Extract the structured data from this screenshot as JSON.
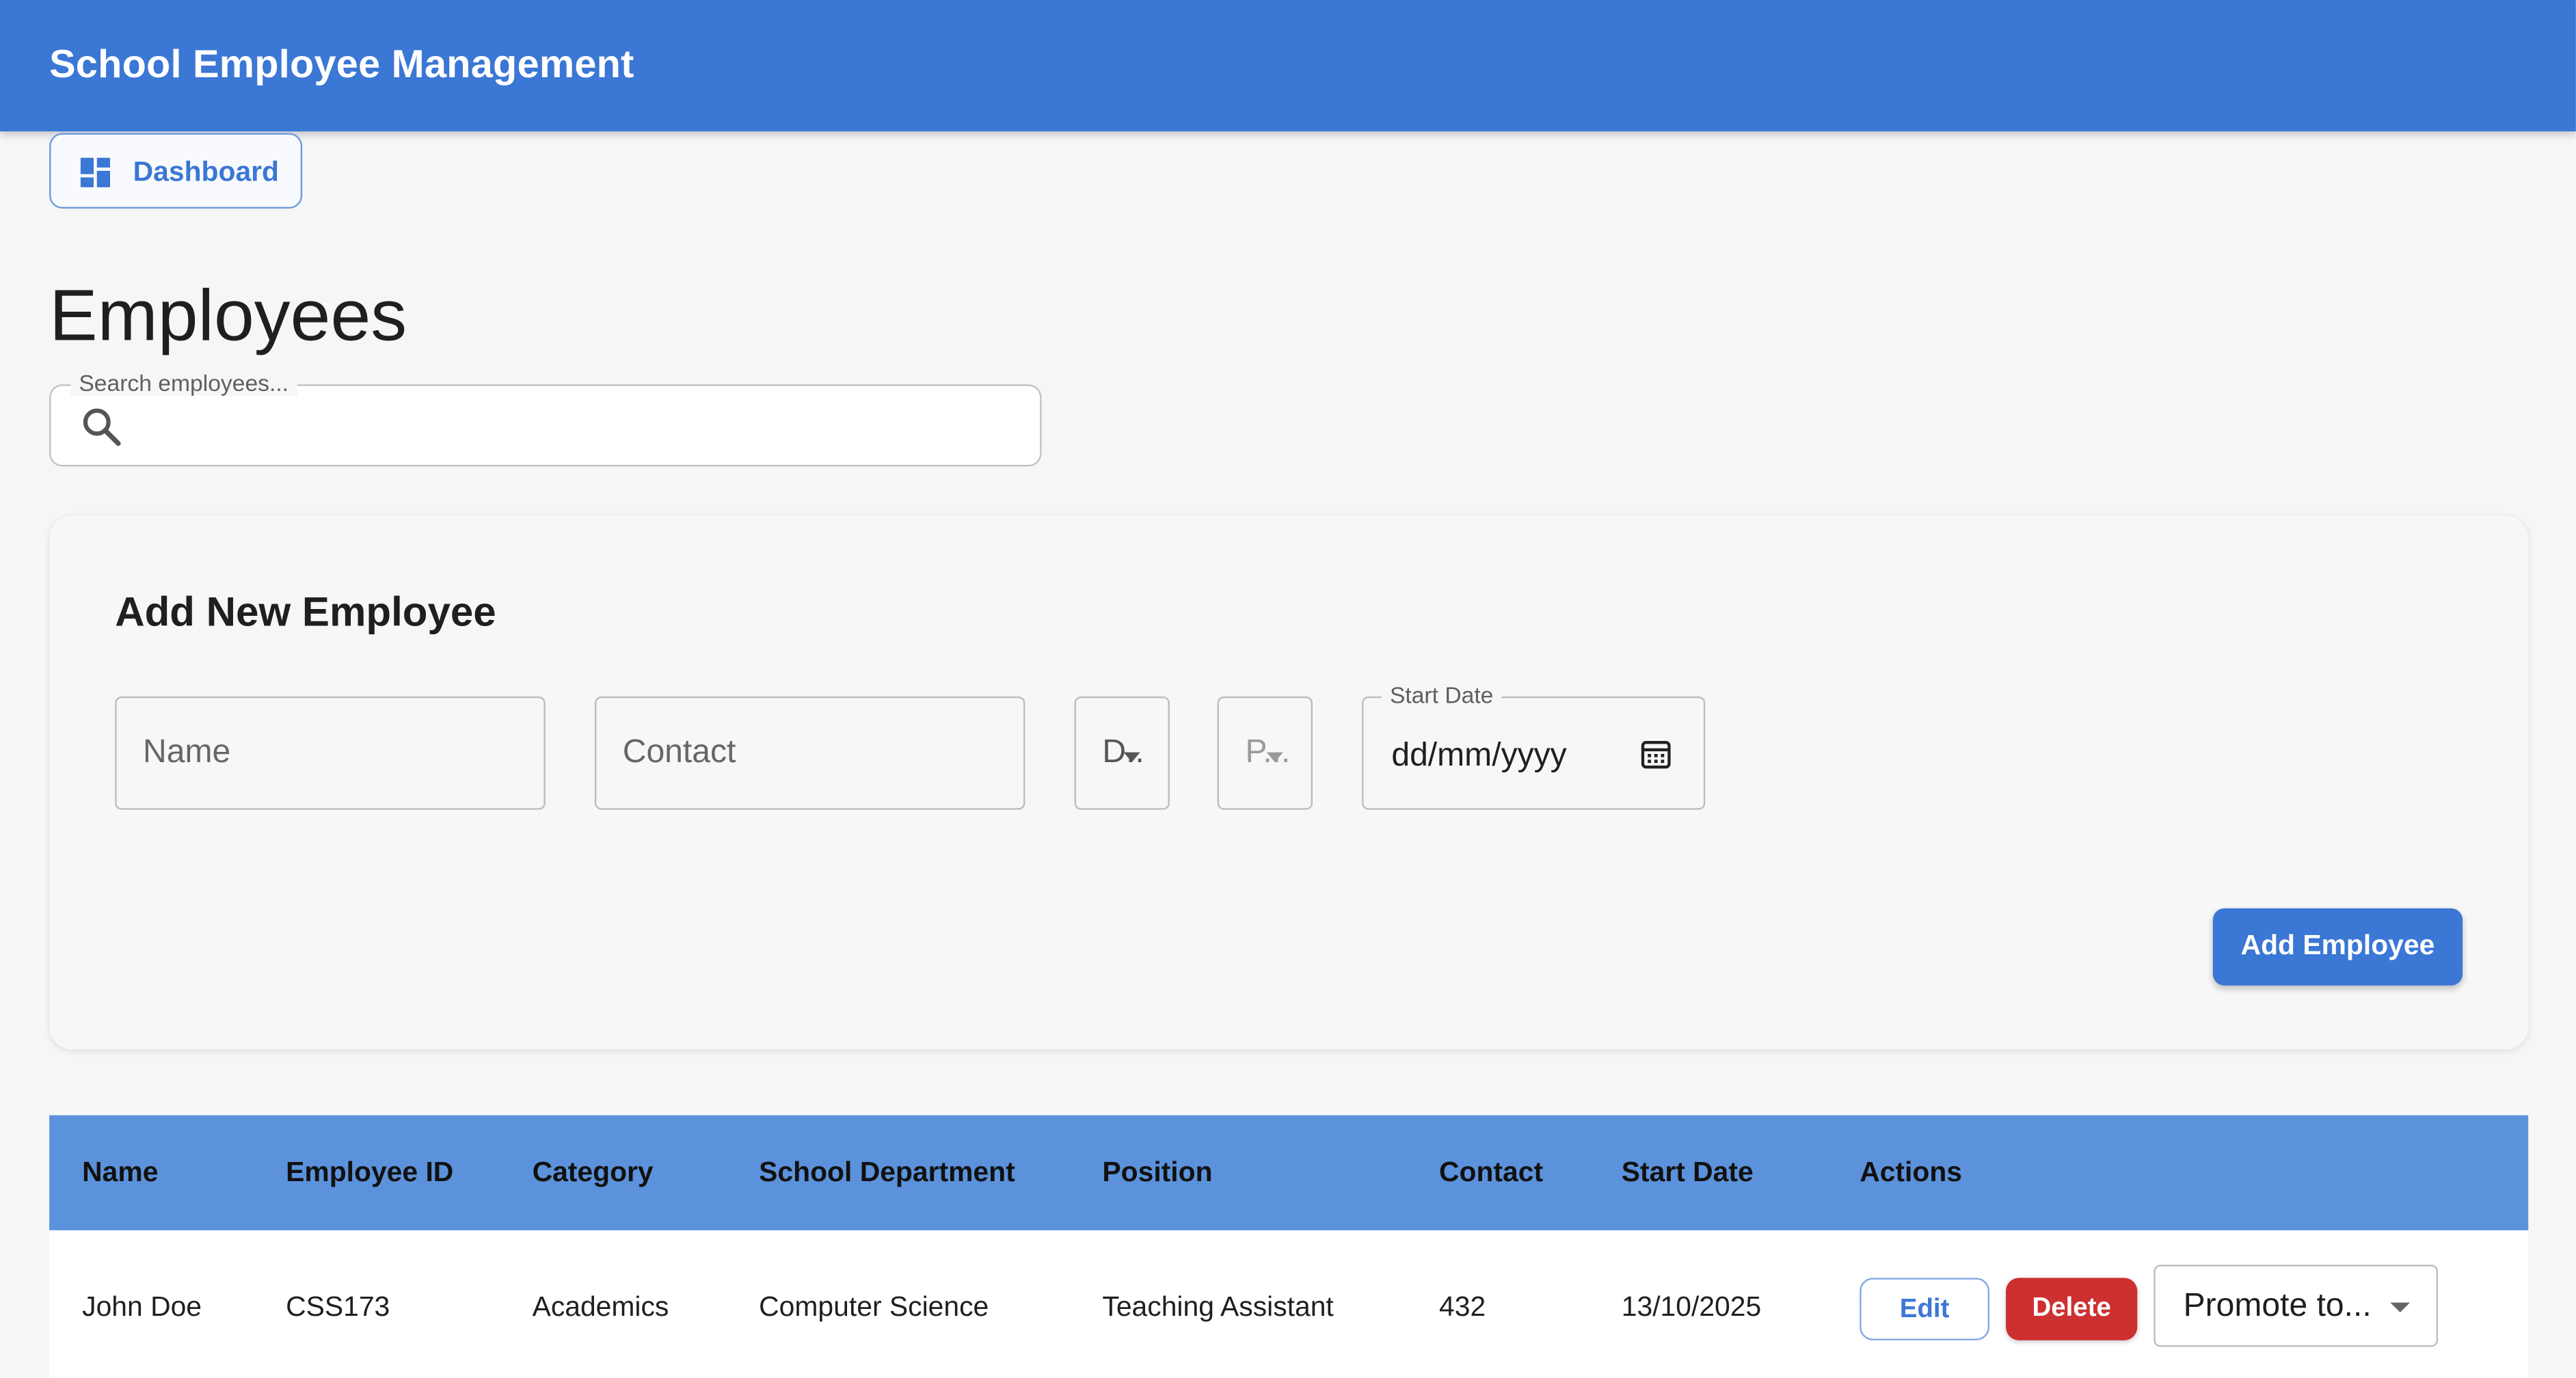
{
  "app": {
    "title": "School Employee Management",
    "accent_color": "#3b77d4"
  },
  "nav": {
    "dashboard_label": "Dashboard",
    "dashboard_icon": "dashboard-grid-icon"
  },
  "page": {
    "title": "Employees"
  },
  "search": {
    "label": "Search employees...",
    "value": "",
    "icon": "search-icon"
  },
  "form": {
    "title": "Add New Employee",
    "name_placeholder": "Name",
    "contact_placeholder": "Contact",
    "department_select_text": "D...",
    "position_select_text": "P...",
    "start_date_label": "Start Date",
    "start_date_value": "dd/mm/yyyy",
    "calendar_icon": "calendar-icon",
    "submit_label": "Add Employee"
  },
  "table": {
    "header_color": "#5b92db",
    "columns": [
      "Name",
      "Employee ID",
      "Category",
      "School Department",
      "Position",
      "Contact",
      "Start Date",
      "Actions"
    ],
    "rows": [
      {
        "name": "John Doe",
        "employee_id": "CSS173",
        "category": "Academics",
        "department": "Computer Science",
        "position": "Teaching Assistant",
        "contact": "432",
        "start_date": "13/10/2025",
        "edit_label": "Edit",
        "delete_label": "Delete",
        "promote_label": "Promote to..."
      }
    ],
    "delete_color": "#cd3030"
  }
}
